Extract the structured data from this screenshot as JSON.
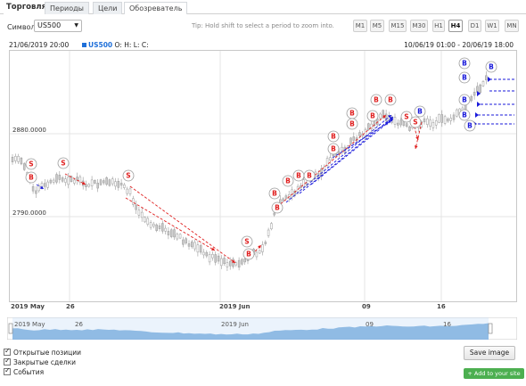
{
  "tabs": [
    {
      "label": "Торговля"
    },
    {
      "label": "Периоды"
    },
    {
      "label": "Цели"
    },
    {
      "label": "Обозреватель"
    }
  ],
  "toolbar": {
    "symbol_label": "Символ",
    "symbol_value": "US500",
    "tip": "Tip: Hold shift to select a period to zoom into.",
    "timeframes": [
      "M1",
      "M5",
      "M15",
      "M30",
      "H1",
      "H4",
      "D1",
      "W1",
      "MN"
    ],
    "active_timeframe": "H4"
  },
  "info": {
    "cursor_date": "21/06/2019 20:00",
    "legend_symbol": "US500",
    "legend_ohlc": "O: H: L: C:",
    "date_range": "10/06/19 01:00 - 20/06/19 18:00"
  },
  "chart_data": {
    "type": "candlestick",
    "y_ticks": [
      "2880.0000",
      "2790.0000"
    ],
    "x_ticks": [
      "2019 May",
      "26",
      "2019 Jun",
      "09",
      "16"
    ],
    "colors": {
      "buy": "#1a1adb",
      "sell": "#e02020",
      "candle": "#aaaaaa",
      "grid": "#e4e4e4",
      "navigator": "#5b9bd5"
    },
    "markers": [
      {
        "label": "S",
        "kind": "sell"
      },
      {
        "label": "S",
        "kind": "sell"
      },
      {
        "label": "B",
        "kind": "sell"
      },
      {
        "label": "S",
        "kind": "sell"
      },
      {
        "label": "S",
        "kind": "sell"
      },
      {
        "label": "B",
        "kind": "sell"
      },
      {
        "label": "B",
        "kind": "sell"
      },
      {
        "label": "B",
        "kind": "sell"
      },
      {
        "label": "B",
        "kind": "sell"
      },
      {
        "label": "B",
        "kind": "sell"
      },
      {
        "label": "B",
        "kind": "sell"
      },
      {
        "label": "B",
        "kind": "sell"
      },
      {
        "label": "B",
        "kind": "sell"
      },
      {
        "label": "B",
        "kind": "sell"
      },
      {
        "label": "B",
        "kind": "sell"
      },
      {
        "label": "B",
        "kind": "sell"
      },
      {
        "label": "B",
        "kind": "sell"
      },
      {
        "label": "B",
        "kind": "sell"
      },
      {
        "label": "S",
        "kind": "sell"
      },
      {
        "label": "S",
        "kind": "sell"
      },
      {
        "label": "B",
        "kind": "buy"
      },
      {
        "label": "B",
        "kind": "buy"
      },
      {
        "label": "B",
        "kind": "buy"
      },
      {
        "label": "B",
        "kind": "buy"
      },
      {
        "label": "B",
        "kind": "buy"
      },
      {
        "label": "B",
        "kind": "buy"
      },
      {
        "label": "B",
        "kind": "buy"
      }
    ]
  },
  "navigator": {
    "labels": [
      "2019 May",
      "26",
      "2019 Jun",
      "09",
      "16"
    ]
  },
  "options": [
    {
      "label": "Открытые позиции",
      "checked": true
    },
    {
      "label": "Закрытые сделки",
      "checked": true
    },
    {
      "label": "События",
      "checked": true
    }
  ],
  "buttons": {
    "save": "Save image",
    "add": "+ Add to your site"
  }
}
